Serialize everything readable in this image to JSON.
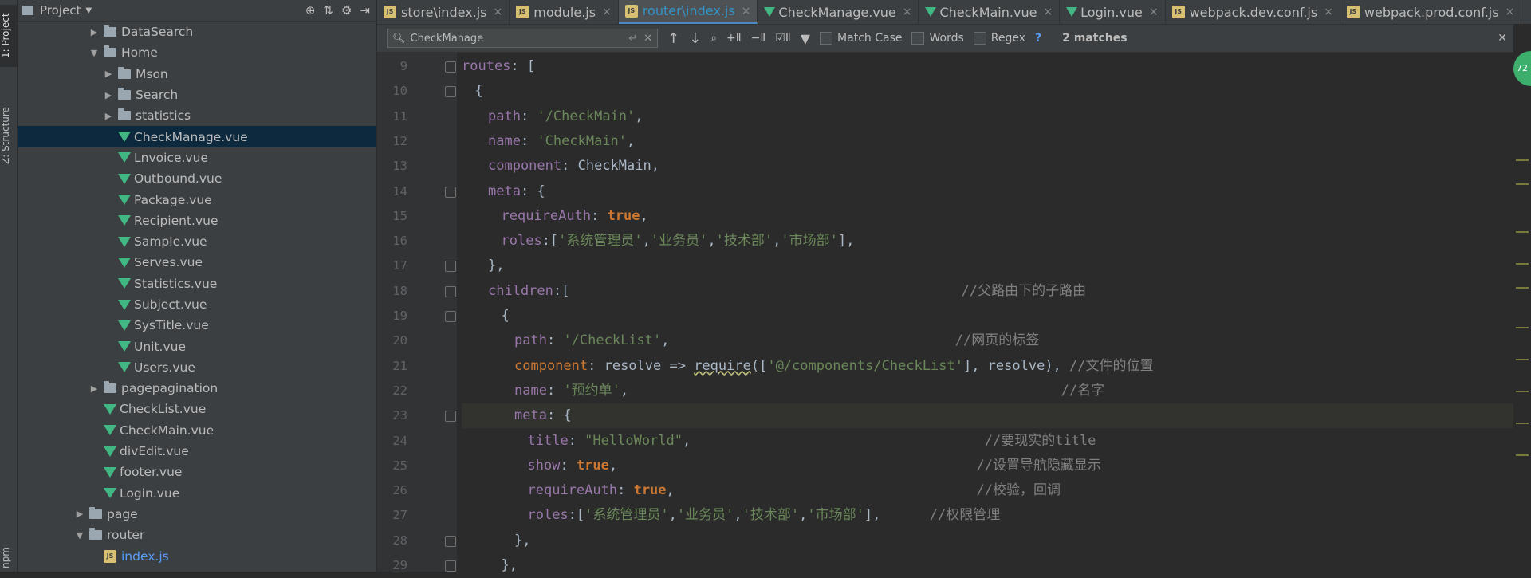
{
  "toolstrip": {
    "project_tab": "1: Project",
    "structure_tab": "Z: Structure",
    "npm_tab": "npm"
  },
  "project": {
    "title": "Project",
    "tree": [
      {
        "label": "DataSearch",
        "type": "folder",
        "depth": 2,
        "expanded": false
      },
      {
        "label": "Home",
        "type": "folder",
        "depth": 2,
        "expanded": true
      },
      {
        "label": "Mson",
        "type": "folder",
        "depth": 3,
        "expanded": false
      },
      {
        "label": "Search",
        "type": "folder",
        "depth": 3,
        "expanded": false
      },
      {
        "label": "statistics",
        "type": "folder",
        "depth": 3,
        "expanded": false
      },
      {
        "label": "CheckManage.vue",
        "type": "vue",
        "depth": 3,
        "selected": true
      },
      {
        "label": "Lnvoice.vue",
        "type": "vue",
        "depth": 3
      },
      {
        "label": "Outbound.vue",
        "type": "vue",
        "depth": 3
      },
      {
        "label": "Package.vue",
        "type": "vue",
        "depth": 3
      },
      {
        "label": "Recipient.vue",
        "type": "vue",
        "depth": 3
      },
      {
        "label": "Sample.vue",
        "type": "vue",
        "depth": 3
      },
      {
        "label": "Serves.vue",
        "type": "vue",
        "depth": 3
      },
      {
        "label": "Statistics.vue",
        "type": "vue",
        "depth": 3
      },
      {
        "label": "Subject.vue",
        "type": "vue",
        "depth": 3
      },
      {
        "label": "SysTitle.vue",
        "type": "vue",
        "depth": 3
      },
      {
        "label": "Unit.vue",
        "type": "vue",
        "depth": 3
      },
      {
        "label": "Users.vue",
        "type": "vue",
        "depth": 3
      },
      {
        "label": "pagepagination",
        "type": "folder",
        "depth": 2,
        "expanded": false
      },
      {
        "label": "CheckList.vue",
        "type": "vue",
        "depth": 2
      },
      {
        "label": "CheckMain.vue",
        "type": "vue",
        "depth": 2
      },
      {
        "label": "divEdit.vue",
        "type": "vue",
        "depth": 2
      },
      {
        "label": "footer.vue",
        "type": "vue",
        "depth": 2
      },
      {
        "label": "Login.vue",
        "type": "vue",
        "depth": 2
      },
      {
        "label": "page",
        "type": "folder",
        "depth": 1,
        "expanded": false
      },
      {
        "label": "router",
        "type": "folder",
        "depth": 1,
        "expanded": true
      },
      {
        "label": "index.js",
        "type": "js",
        "depth": 2
      }
    ]
  },
  "tabs": [
    {
      "label": "store\\index.js",
      "icon": "js"
    },
    {
      "label": "module.js",
      "icon": "js"
    },
    {
      "label": "router\\index.js",
      "icon": "js",
      "active": true
    },
    {
      "label": "CheckManage.vue",
      "icon": "vue"
    },
    {
      "label": "CheckMain.vue",
      "icon": "vue"
    },
    {
      "label": "Login.vue",
      "icon": "vue"
    },
    {
      "label": "webpack.dev.conf.js",
      "icon": "js"
    },
    {
      "label": "webpack.prod.conf.js",
      "icon": "js"
    }
  ],
  "findbar": {
    "query": "CheckManage",
    "match_case": "Match Case",
    "words": "Words",
    "regex": "Regex",
    "help": "?",
    "matches": "2 matches"
  },
  "code": [
    {
      "n": "9",
      "indent": 0,
      "parts": [
        [
          "prop",
          "routes"
        ],
        [
          "p",
          ": ["
        ]
      ]
    },
    {
      "n": "10",
      "indent": 1,
      "parts": [
        [
          "p",
          "{"
        ]
      ]
    },
    {
      "n": "11",
      "indent": 2,
      "parts": [
        [
          "prop",
          "path"
        ],
        [
          "p",
          ": "
        ],
        [
          "str",
          "'/CheckMain'"
        ],
        [
          "p",
          ","
        ]
      ]
    },
    {
      "n": "12",
      "indent": 2,
      "parts": [
        [
          "prop",
          "name"
        ],
        [
          "p",
          ": "
        ],
        [
          "str",
          "'CheckMain'"
        ],
        [
          "p",
          ","
        ]
      ]
    },
    {
      "n": "13",
      "indent": 2,
      "parts": [
        [
          "prop",
          "component"
        ],
        [
          "p",
          ": CheckMain,"
        ]
      ]
    },
    {
      "n": "14",
      "indent": 2,
      "parts": [
        [
          "prop",
          "meta"
        ],
        [
          "p",
          ": {"
        ]
      ]
    },
    {
      "n": "15",
      "indent": 3,
      "parts": [
        [
          "prop",
          "requireAuth"
        ],
        [
          "p",
          ": "
        ],
        [
          "kw",
          "true"
        ],
        [
          "p",
          ","
        ]
      ]
    },
    {
      "n": "16",
      "indent": 3,
      "parts": [
        [
          "prop",
          "roles"
        ],
        [
          "p",
          ":["
        ],
        [
          "str",
          "'系统管理员'"
        ],
        [
          "p",
          ","
        ],
        [
          "str",
          "'业务员'"
        ],
        [
          "p",
          ","
        ],
        [
          "str",
          "'技术部'"
        ],
        [
          "p",
          ","
        ],
        [
          "str",
          "'市场部'"
        ],
        [
          "p",
          "],"
        ]
      ]
    },
    {
      "n": "17",
      "indent": 2,
      "parts": [
        [
          "p",
          "},"
        ]
      ]
    },
    {
      "n": "18",
      "indent": 2,
      "parts": [
        [
          "prop",
          "children"
        ],
        [
          "p",
          ":["
        ],
        [
          "pad",
          "                                                "
        ],
        [
          "cm",
          "//父路由下的子路由"
        ]
      ]
    },
    {
      "n": "19",
      "indent": 3,
      "parts": [
        [
          "p",
          "{"
        ]
      ]
    },
    {
      "n": "20",
      "indent": 4,
      "parts": [
        [
          "prop",
          "path"
        ],
        [
          "p",
          ": "
        ],
        [
          "str",
          "'/CheckList'"
        ],
        [
          "p",
          ","
        ],
        [
          "pad",
          "                                   "
        ],
        [
          "cm",
          "//网页的标签"
        ]
      ]
    },
    {
      "n": "21",
      "indent": 4,
      "parts": [
        [
          "kw2",
          "component"
        ],
        [
          "p",
          ": resolve => "
        ],
        [
          "uline",
          "require"
        ],
        [
          "p",
          "(["
        ],
        [
          "str",
          "'@/components/CheckList'"
        ],
        [
          "p",
          "], resolve), "
        ],
        [
          "cm",
          "//文件的位置"
        ]
      ]
    },
    {
      "n": "22",
      "indent": 4,
      "parts": [
        [
          "prop",
          "name"
        ],
        [
          "p",
          ": "
        ],
        [
          "str",
          "'预约单'"
        ],
        [
          "p",
          ","
        ],
        [
          "pad",
          "                                                     "
        ],
        [
          "cm",
          "//名字"
        ]
      ]
    },
    {
      "n": "23",
      "indent": 4,
      "hl": true,
      "parts": [
        [
          "prop",
          "meta"
        ],
        [
          "p",
          ": {"
        ]
      ]
    },
    {
      "n": "24",
      "indent": 5,
      "parts": [
        [
          "prop",
          "title"
        ],
        [
          "p",
          ": "
        ],
        [
          "str",
          "\"HelloWorld\""
        ],
        [
          "p",
          ","
        ],
        [
          "pad",
          "                                    "
        ],
        [
          "cm",
          "//要现实的title"
        ]
      ]
    },
    {
      "n": "25",
      "indent": 5,
      "parts": [
        [
          "prop",
          "show"
        ],
        [
          "p",
          ": "
        ],
        [
          "kw",
          "true"
        ],
        [
          "p",
          ","
        ],
        [
          "pad",
          "                                            "
        ],
        [
          "cm",
          "//设置导航隐藏显示"
        ]
      ]
    },
    {
      "n": "26",
      "indent": 5,
      "parts": [
        [
          "prop",
          "requireAuth"
        ],
        [
          "p",
          ": "
        ],
        [
          "kw",
          "true"
        ],
        [
          "p",
          ","
        ],
        [
          "pad",
          "                                     "
        ],
        [
          "cm",
          "//校验，回调"
        ]
      ]
    },
    {
      "n": "27",
      "indent": 5,
      "parts": [
        [
          "prop",
          "roles"
        ],
        [
          "p",
          ":["
        ],
        [
          "str",
          "'系统管理员'"
        ],
        [
          "p",
          ","
        ],
        [
          "str",
          "'业务员'"
        ],
        [
          "p",
          ","
        ],
        [
          "str",
          "'技术部'"
        ],
        [
          "p",
          ","
        ],
        [
          "str",
          "'市场部'"
        ],
        [
          "p",
          "],"
        ],
        [
          "pad",
          "      "
        ],
        [
          "cm",
          "//权限管理"
        ]
      ]
    },
    {
      "n": "28",
      "indent": 4,
      "parts": [
        [
          "p",
          "},"
        ]
      ]
    },
    {
      "n": "29",
      "indent": 3,
      "parts": [
        [
          "p",
          "},"
        ]
      ]
    }
  ],
  "badge": "72",
  "colors": {
    "accent": "#4a88c7",
    "vue": "#41b883",
    "keyword": "#cc7832",
    "string": "#6a8759",
    "comment": "#808080",
    "property": "#9876aa"
  }
}
